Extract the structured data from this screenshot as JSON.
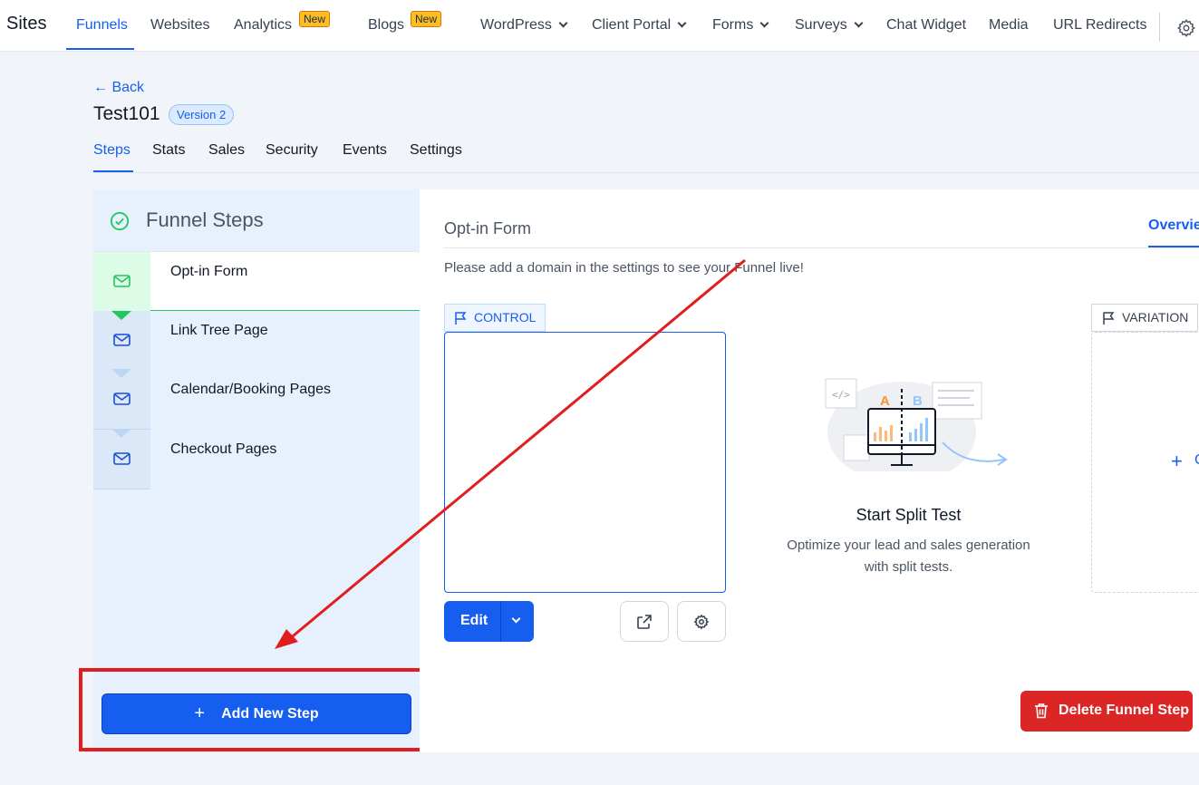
{
  "nav": {
    "brand": "Sites",
    "items": [
      {
        "label": "Funnels",
        "active": true
      },
      {
        "label": "Websites"
      },
      {
        "label": "Analytics",
        "badge": "New"
      },
      {
        "label": "Blogs",
        "badge": "New"
      },
      {
        "label": "WordPress",
        "dropdown": true
      },
      {
        "label": "Client Portal",
        "dropdown": true
      },
      {
        "label": "Forms",
        "dropdown": true
      },
      {
        "label": "Surveys",
        "dropdown": true
      },
      {
        "label": "Chat Widget"
      },
      {
        "label": "Media"
      },
      {
        "label": "URL Redirects"
      }
    ],
    "settings_icon": "gear-icon"
  },
  "header": {
    "back_label": "← Back",
    "funnel_name": "Test101",
    "version_badge": "Version 2",
    "tabs": [
      {
        "label": "Steps",
        "active": true
      },
      {
        "label": "Stats"
      },
      {
        "label": "Sales"
      },
      {
        "label": "Security"
      },
      {
        "label": "Events"
      },
      {
        "label": "Settings"
      }
    ]
  },
  "sidebar": {
    "title": "Funnel Steps",
    "steps": [
      {
        "label": "Opt-in Form",
        "icon": "mail-icon",
        "active": true
      },
      {
        "label": "Link Tree Page",
        "icon": "mail-icon"
      },
      {
        "label": "Calendar/Booking Pages",
        "icon": "mail-icon"
      },
      {
        "label": "Checkout Pages",
        "icon": "mail-icon"
      }
    ],
    "add_step_label": "Add New Step",
    "add_step_icon": "+"
  },
  "main": {
    "step_title": "Opt-in Form",
    "overview_tab": "Overview",
    "domain_notice": "Please add a domain in the settings to see your Funnel live!",
    "control_label": "CONTROL",
    "variation_label": "VARIATION",
    "variation_add": "+",
    "variation_add_text": "C",
    "edit_label": "Edit",
    "split_test": {
      "ab_a": "A",
      "ab_b": "B",
      "title": "Start Split Test",
      "description": "Optimize your lead and sales generation with split tests."
    },
    "delete_label": "Delete Funnel Step"
  },
  "colors": {
    "accent": "#155eef",
    "danger": "#dc2626",
    "success": "#22c55e",
    "badge": "#fbbf24",
    "annotation": "#e11d1d"
  }
}
